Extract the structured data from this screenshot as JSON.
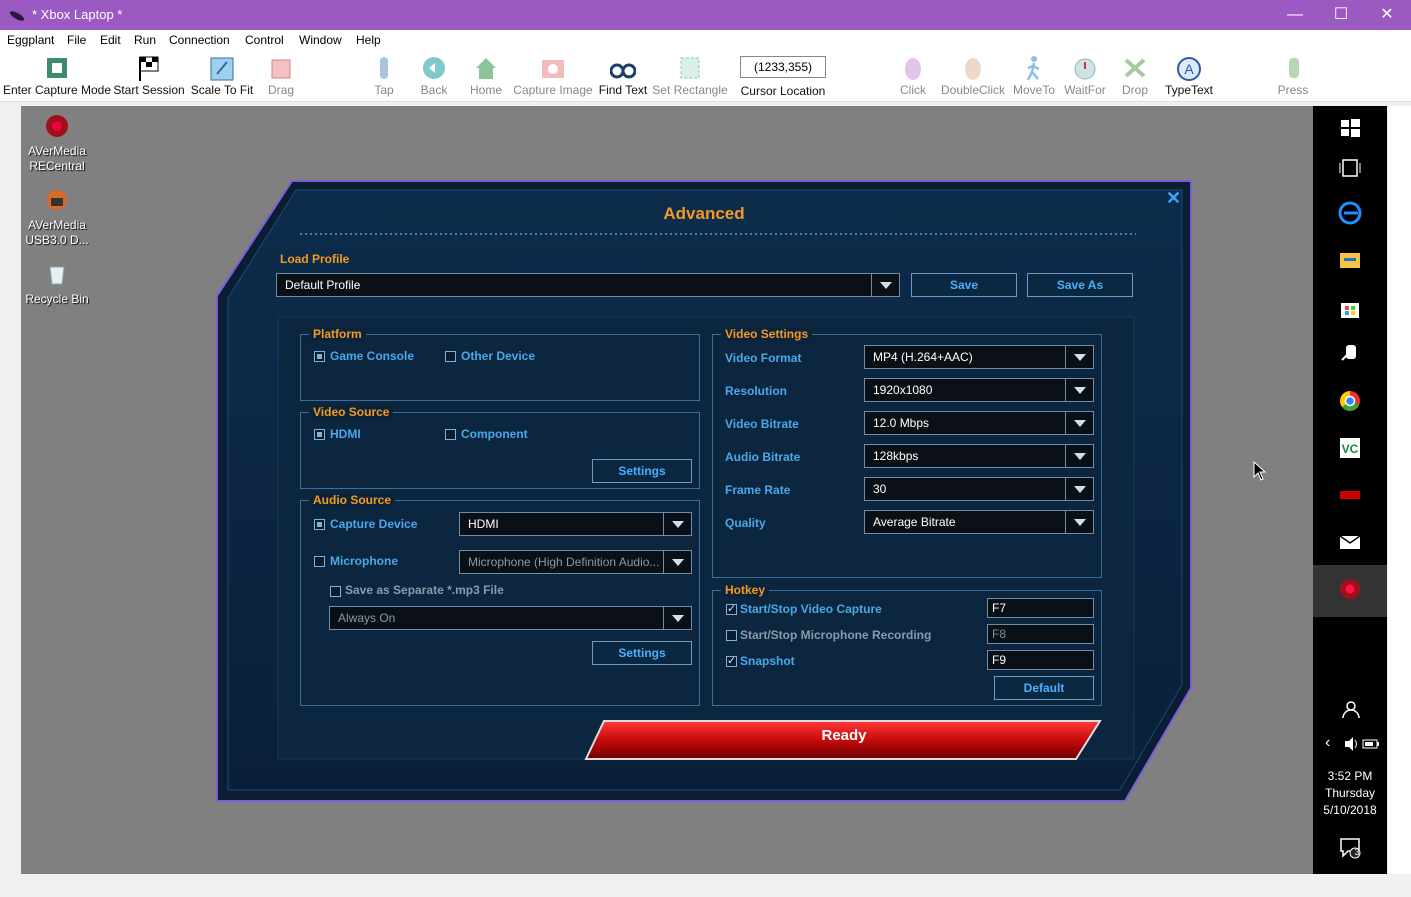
{
  "window": {
    "title": "* Xbox Laptop *"
  },
  "menu": [
    "Eggplant",
    "File",
    "Edit",
    "Run",
    "Connection",
    "Control",
    "Window",
    "Help"
  ],
  "toolbar": {
    "enter_capture": "Enter Capture Mode",
    "start_session": "Start Session",
    "scale_to_fit": "Scale To Fit",
    "drag": "Drag",
    "tap": "Tap",
    "back": "Back",
    "home": "Home",
    "capture_image": "Capture Image",
    "find_text": "Find Text",
    "set_rectangle": "Set Rectangle",
    "cursor_value": "(1233,355)",
    "cursor_label": "Cursor Location",
    "click": "Click",
    "doubleclick": "DoubleClick",
    "moveto": "MoveTo",
    "waitfor": "WaitFor",
    "drop": "Drop",
    "typetext": "TypeText",
    "press": "Press"
  },
  "desktop": {
    "icon1": [
      "AVerMedia",
      "RECentral"
    ],
    "icon2": [
      "AVerMedia",
      "USB3.0 D..."
    ],
    "icon3": "Recycle Bin"
  },
  "dialog": {
    "title": "Advanced",
    "load_profile_label": "Load Profile",
    "profile_value": "Default Profile",
    "save": "Save",
    "save_as": "Save As",
    "platform": {
      "title": "Platform",
      "game_console": "Game Console",
      "other_device": "Other Device"
    },
    "video_source": {
      "title": "Video Source",
      "hdmi": "HDMI",
      "component": "Component",
      "settings": "Settings"
    },
    "audio_source": {
      "title": "Audio Source",
      "capture_device": "Capture Device",
      "capture_device_value": "HDMI",
      "microphone": "Microphone",
      "microphone_value": "Microphone (High Definition Audio...",
      "save_separate": "Save as Separate *.mp3 File",
      "always_on": "Always On",
      "settings": "Settings"
    },
    "video_settings": {
      "title": "Video Settings",
      "video_format_label": "Video Format",
      "video_format": "MP4 (H.264+AAC)",
      "resolution_label": "Resolution",
      "resolution": "1920x1080",
      "video_bitrate_label": "Video Bitrate",
      "video_bitrate": "12.0 Mbps",
      "audio_bitrate_label": "Audio Bitrate",
      "audio_bitrate": "128kbps",
      "frame_rate_label": "Frame Rate",
      "frame_rate": "30",
      "quality_label": "Quality",
      "quality": "Average Bitrate"
    },
    "hotkey": {
      "title": "Hotkey",
      "start_stop_video": "Start/Stop Video Capture",
      "video_key": "F7",
      "start_stop_mic": "Start/Stop Microphone Recording",
      "mic_key": "F8",
      "snapshot": "Snapshot",
      "snapshot_key": "F9",
      "default": "Default"
    },
    "ready": "Ready"
  },
  "clock": {
    "time": "3:52 PM",
    "day": "Thursday",
    "date": "5/10/2018",
    "notifications": "3"
  }
}
